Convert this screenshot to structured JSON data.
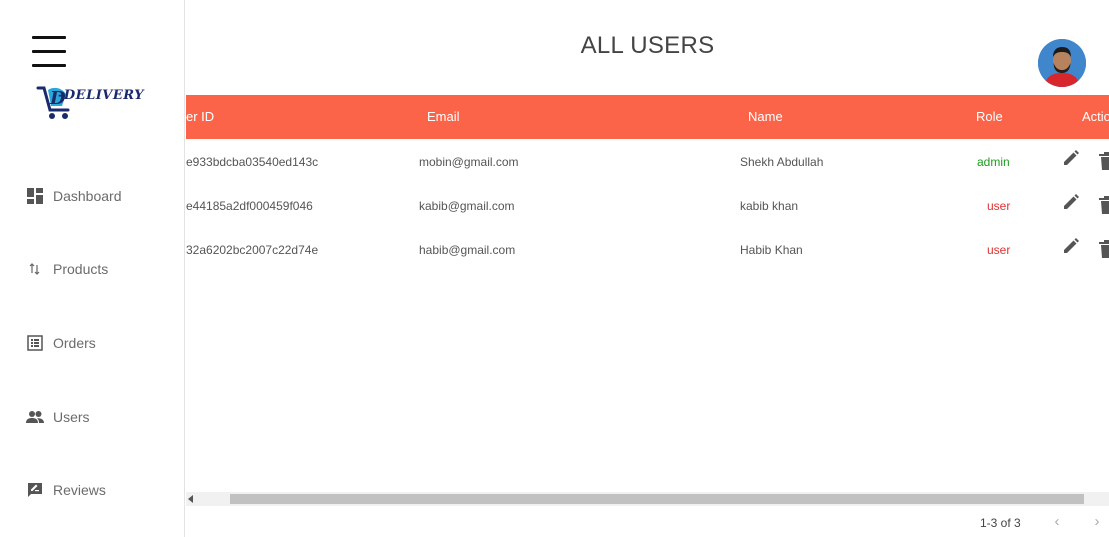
{
  "sidebar": {
    "logo_text": "-DELIVERY",
    "items": [
      {
        "label": "Dashboard",
        "icon": "dashboard-icon"
      },
      {
        "label": "Products",
        "icon": "sort-arrows-icon"
      },
      {
        "label": "Orders",
        "icon": "list-icon"
      },
      {
        "label": "Users",
        "icon": "users-icon"
      },
      {
        "label": "Reviews",
        "icon": "rate-review-icon"
      }
    ]
  },
  "header": {
    "title": "ALL USERS"
  },
  "table": {
    "columns": [
      "er ID",
      "Email",
      "Name",
      "Role",
      "Actio"
    ],
    "rows": [
      {
        "id": "e933bdcba03540ed143c",
        "email": "mobin@gmail.com",
        "name": "Shekh Abdullah",
        "role": "admin"
      },
      {
        "id": "e44185a2df000459f046",
        "email": "kabib@gmail.com",
        "name": "kabib khan",
        "role": "user"
      },
      {
        "id": "32a6202bc2007c22d74e",
        "email": "habib@gmail.com",
        "name": "Habib Khan",
        "role": "user"
      }
    ]
  },
  "pagination": {
    "range": "1-3 of 3",
    "prev": "‹",
    "next": "›"
  },
  "colors": {
    "header_bg": "#fb6448",
    "admin": "#1a9e1a",
    "user": "#e03131"
  }
}
